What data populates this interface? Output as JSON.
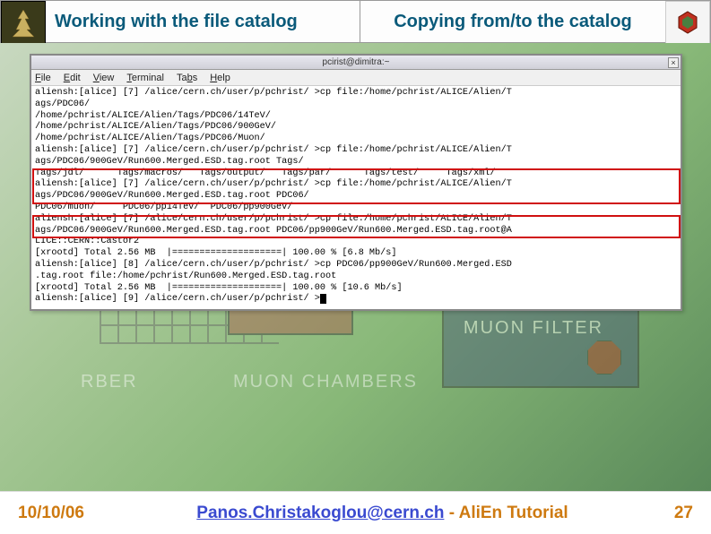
{
  "header": {
    "title_left": "Working with the file catalog",
    "title_right": "Copying from/to the catalog"
  },
  "terminal": {
    "title": "pcirist@dimitra:~",
    "close": "×",
    "menu": {
      "file": "File",
      "edit": "Edit",
      "view": "View",
      "terminal": "Terminal",
      "tabs": "Tabs",
      "help": "Help"
    },
    "lines": [
      "aliensh:[alice] [7] /alice/cern.ch/user/p/pchrist/ >cp file:/home/pchrist/ALICE/Alien/T",
      "ags/PDC06/",
      "/home/pchrist/ALICE/Alien/Tags/PDC06/14TeV/",
      "/home/pchrist/ALICE/Alien/Tags/PDC06/900GeV/",
      "/home/pchrist/ALICE/Alien/Tags/PDC06/Muon/",
      "aliensh:[alice] [7] /alice/cern.ch/user/p/pchrist/ >cp file:/home/pchrist/ALICE/Alien/T",
      "ags/PDC06/900GeV/Run600.Merged.ESD.tag.root Tags/",
      "Tags/jdl/      Tags/macros/   Tags/output/   Tags/par/      Tags/test/     Tags/xml/",
      "aliensh:[alice] [7] /alice/cern.ch/user/p/pchrist/ >cp file:/home/pchrist/ALICE/Alien/T",
      "ags/PDC06/900GeV/Run600.Merged.ESD.tag.root PDC06/",
      "PDC06/muon/     PDC06/pp14TeV/  PDC06/pp900GeV/",
      "aliensh:[alice] [7] /alice/cern.ch/user/p/pchrist/ >cp file:/home/pchrist/ALICE/Alien/T",
      "ags/PDC06/900GeV/Run600.Merged.ESD.tag.root PDC06/pp900GeV/Run600.Merged.ESD.tag.root@A",
      "LICE::CERN::Castor2",
      "[xrootd] Total 2.56 MB  |====================| 100.00 % [6.8 Mb/s]",
      "aliensh:[alice] [8] /alice/cern.ch/user/p/pchrist/ >cp PDC06/pp900GeV/Run600.Merged.ESD",
      ".tag.root file:/home/pchrist/Run600.Merged.ESD.tag.root",
      "[xrootd] Total 2.56 MB  |====================| 100.00 % [10.6 Mb/s]",
      "aliensh:[alice] [9] /alice/cern.ch/user/p/pchrist/ >"
    ]
  },
  "background": {
    "label1": "RBER",
    "label2": "MUON CHAMBERS",
    "label3": "MUON FILTER"
  },
  "footer": {
    "date": "10/10/06",
    "email": "Panos.Christakoglou@cern.ch",
    "tail": " - AliEn Tutorial",
    "page": "27"
  }
}
